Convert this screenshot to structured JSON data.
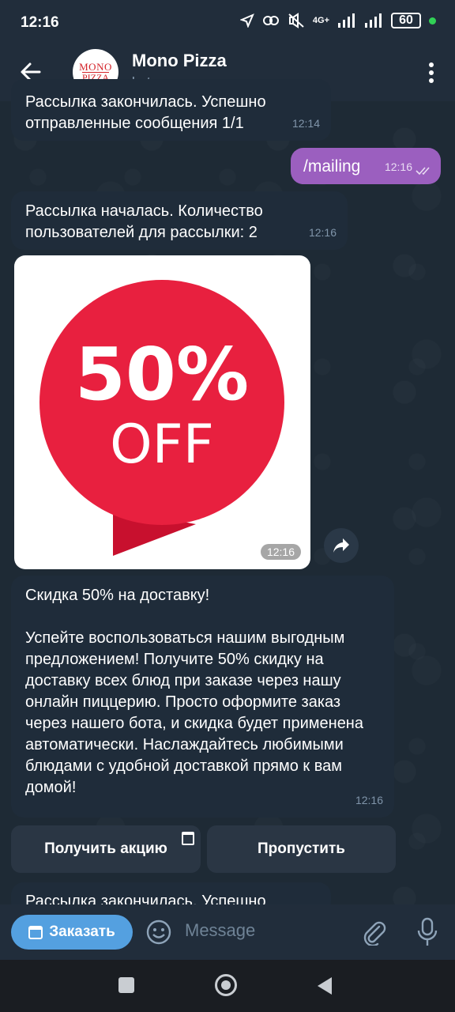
{
  "status": {
    "time": "12:16",
    "network": "4G+",
    "battery": "60"
  },
  "header": {
    "title": "Mono Pizza",
    "subtitle": "bot",
    "avatar_line1": "MONO",
    "avatar_line2": "PIZZA"
  },
  "messages": [
    {
      "text": "Рассылка закончилась. Успешно отправленные сообщения 1/1",
      "time": "12:14"
    },
    {
      "text": "/mailing",
      "time": "12:16"
    },
    {
      "text": "Рассылка началась. Количество пользователей для рассылки: 2",
      "time": "12:16"
    },
    {
      "image_big": "50%",
      "image_small": "OFF",
      "time": "12:16"
    },
    {
      "line1": "Скидка 50% на доставку!",
      "body": "Успейте воспользоваться нашим выгодным предложением! Получите 50% скидку на доставку всех блюд при заказе через нашу онлайн пиццерию. Просто оформите заказ через нашего бота, и скидка будет применена автоматически. Наслаждайтесь любимыми блюдами с удобной доставкой прямо к вам домой!",
      "time": "12:16"
    },
    {
      "text": "Рассылка закончилась. Успешно"
    }
  ],
  "keyboard": {
    "get_promo": "Получить акцию",
    "skip": "Пропустить"
  },
  "input": {
    "order_button": "Заказать",
    "placeholder": "Message"
  },
  "colors": {
    "accent": "#54a0e0",
    "outgoing": "#9b5fbf",
    "promo_red": "#e8203f"
  }
}
